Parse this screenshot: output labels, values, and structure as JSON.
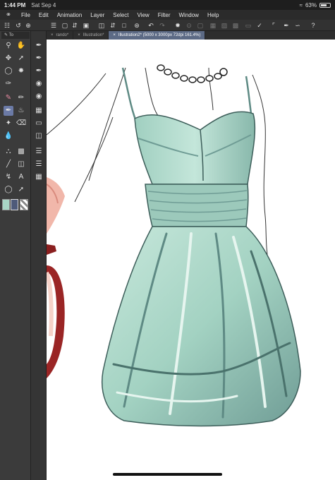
{
  "status": {
    "time": "1:44 PM",
    "date": "Sat Sep 4",
    "battery": "63%",
    "battery_level": 0.63
  },
  "menu": [
    "File",
    "Edit",
    "Animation",
    "Layer",
    "Select",
    "View",
    "Filter",
    "Window",
    "Help"
  ],
  "tool_panel_label": "To",
  "tabs": [
    {
      "label": "rando*"
    },
    {
      "label": "Illustration*"
    },
    {
      "label": "Illustration2* (5000 x 3000px 72dpi 161.4%)"
    }
  ],
  "colors": {
    "canvas": "#ffffff",
    "selected_tool": "#6b7aa6",
    "active_tab": "#5c6a85",
    "dress": "#a9d6c6",
    "dress_shadow": "#5e8a84",
    "sandal": "#9a2525"
  }
}
